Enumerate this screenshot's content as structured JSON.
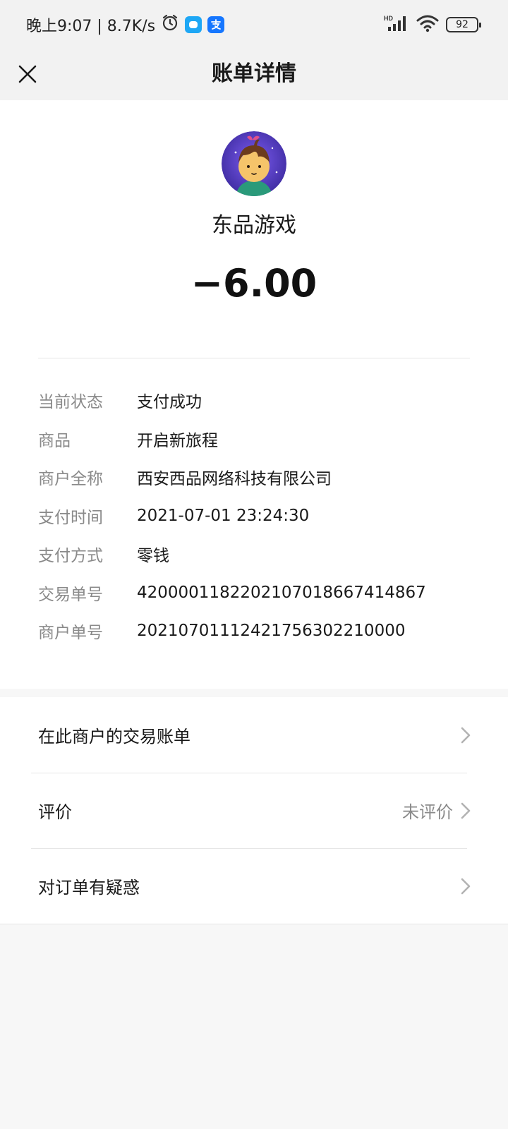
{
  "status_bar": {
    "time_speed": "晚上9:07 | 8.7K/s",
    "battery": "92",
    "network_label": "HD"
  },
  "nav": {
    "title": "账单详情"
  },
  "bill": {
    "merchant": "东品游戏",
    "amount": "−6.00"
  },
  "details": [
    {
      "label": "当前状态",
      "value": "支付成功"
    },
    {
      "label": "商品",
      "value": "开启新旅程"
    },
    {
      "label": "商户全称",
      "value": "西安西品网络科技有限公司"
    },
    {
      "label": "支付时间",
      "value": "2021-07-01 23:24:30"
    },
    {
      "label": "支付方式",
      "value": "零钱"
    },
    {
      "label": "交易单号",
      "value": "4200001182202107018667414867"
    },
    {
      "label": "商户单号",
      "value": "20210701112421756302210000"
    }
  ],
  "menu": [
    {
      "label": "在此商户的交易账单",
      "extra": ""
    },
    {
      "label": "评价",
      "extra": "未评价"
    },
    {
      "label": "对订单有疑惑",
      "extra": ""
    }
  ]
}
